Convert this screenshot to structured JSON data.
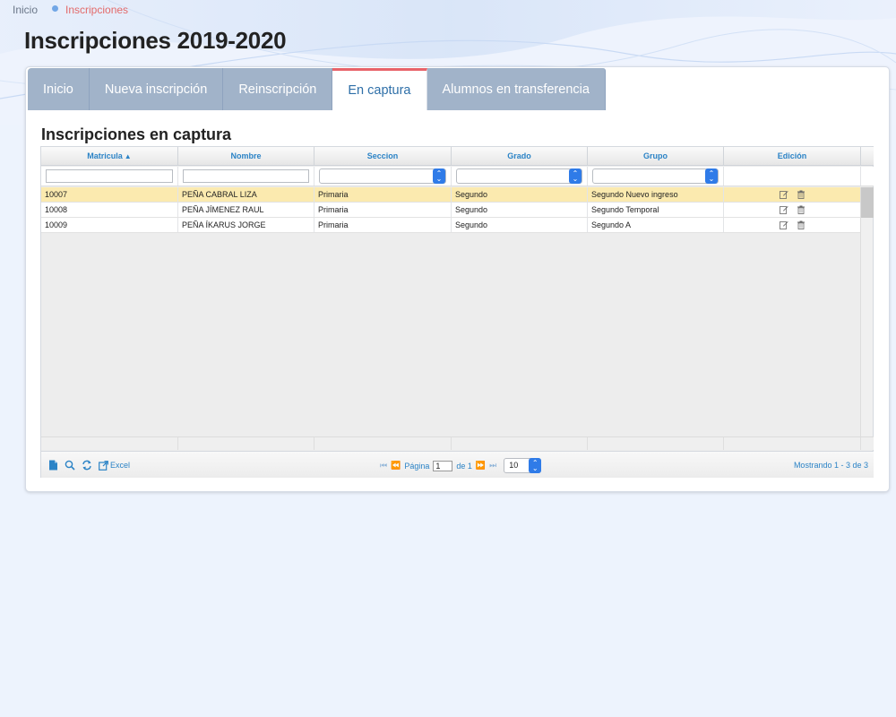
{
  "breadcrumb": {
    "home": "Inicio",
    "current": "Inscripciones"
  },
  "page_title": "Inscripciones 2019-2020",
  "tabs": [
    {
      "label": "Inicio",
      "active": false
    },
    {
      "label": "Nueva inscripción",
      "active": false
    },
    {
      "label": "Reinscripción",
      "active": false
    },
    {
      "label": "En captura",
      "active": true
    },
    {
      "label": "Alumnos en transferencia",
      "active": false
    }
  ],
  "section_title": "Inscripciones en captura",
  "grid": {
    "columns": [
      "Matricula",
      "Nombre",
      "Seccion",
      "Grado",
      "Grupo",
      "Edición"
    ],
    "rows": [
      {
        "matricula": "10007",
        "nombre": "PEÑA CABRAL LIZA",
        "seccion": "Primaria",
        "grado": "Segundo",
        "grupo": "Segundo Nuevo ingreso",
        "selected": true
      },
      {
        "matricula": "10008",
        "nombre": "PEÑA JÍMENEZ RAUL",
        "seccion": "Primaria",
        "grado": "Segundo",
        "grupo": "Segundo Temporal",
        "selected": false
      },
      {
        "matricula": "10009",
        "nombre": "PEÑA ÍKARUS JORGE",
        "seccion": "Primaria",
        "grado": "Segundo",
        "grupo": "Segundo A",
        "selected": false
      }
    ]
  },
  "pager": {
    "excel_label": "Excel",
    "page_label": "Página",
    "page_value": "1",
    "of_label": "de 1",
    "page_size": "10",
    "summary": "Mostrando 1 - 3 de 3"
  },
  "colors": {
    "tab_bg": "#a1b3c9",
    "tab_active_border": "#e8636a",
    "link_blue": "#2b83c6",
    "row_selected": "#fbeaaf",
    "select_button": "#2f7be8"
  }
}
